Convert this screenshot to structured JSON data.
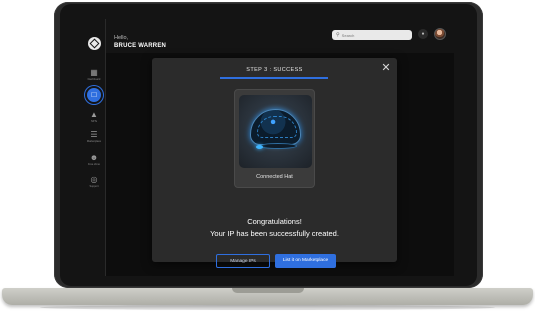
{
  "header": {
    "hello": "Hello,",
    "user_name": "BRUCE WARREN",
    "search_placeholder": "Search"
  },
  "sidebar": {
    "items": [
      {
        "label": "Dashboard",
        "icon": "grid-icon",
        "active": false
      },
      {
        "label": "",
        "icon": "document-icon",
        "active": true
      },
      {
        "label": "NFTs",
        "icon": "box-icon",
        "active": false
      },
      {
        "label": "Marketplace",
        "icon": "cart-icon",
        "active": false
      },
      {
        "label": "Free Zone",
        "icon": "users-icon",
        "active": false
      },
      {
        "label": "Support",
        "icon": "support-icon",
        "active": false
      }
    ]
  },
  "modal": {
    "step_title": "STEP 3 : SUCCESS",
    "card_label": "Connected Hat",
    "message_line1": "Congratulations!",
    "message_line2": "Your IP has been successfully created.",
    "manage_button": "Manage IPs",
    "list_button": "List it on Marketplace"
  },
  "colors": {
    "accent": "#2f6fdf",
    "modal_bg": "#2b2b2b",
    "app_bg": "#141414"
  }
}
